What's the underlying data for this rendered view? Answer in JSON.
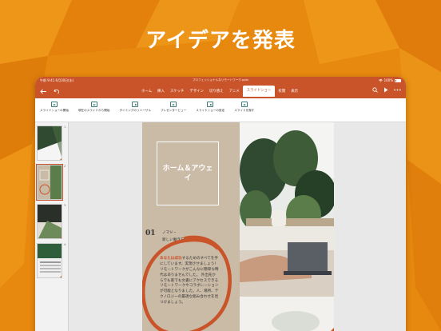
{
  "headline": "アイデアを発表",
  "colors": {
    "accent": "#C9542A",
    "background": "#E8890F",
    "slide_beige": "#CABBA7"
  },
  "status": {
    "time": "午前 9:41",
    "date": "6月30日(水)",
    "battery": "100%"
  },
  "doc_title": "プロフェッショナルなリモートワーク.pptx",
  "nav": {
    "back_icon": "back-arrow-icon",
    "undo_icon": "undo-icon"
  },
  "tabs": [
    "ホーム",
    "挿入",
    "スケッチ",
    "デザイン",
    "切り替え",
    "アニメ",
    "スライドショー",
    "校閲",
    "表示"
  ],
  "active_tab": "スライドショー",
  "toolbar": [
    {
      "label": "スライドショーの開始",
      "icon": "play-slideshow-icon"
    },
    {
      "label": "現在のスライドから開始",
      "icon": "play-from-current-icon"
    },
    {
      "label": "タイミングのリハーサル",
      "icon": "rehearse-timings-icon"
    },
    {
      "label": "プレゼンタービュー",
      "icon": "presenter-view-icon"
    },
    {
      "label": "スライドショーの設定",
      "icon": "slideshow-settings-icon"
    },
    {
      "label": "スライドを隠す",
      "icon": "hide-slide-icon"
    }
  ],
  "thumbnails": [
    {
      "num": "1",
      "selected": false
    },
    {
      "num": "2",
      "selected": true
    },
    {
      "num": "3",
      "selected": false
    },
    {
      "num": "4",
      "selected": false
    }
  ],
  "slide": {
    "title": "ホーム＆アウェイ",
    "section_number": "01",
    "section_lines": [
      "ノマド・",
      "新しい働き方"
    ],
    "body_highlight": "あなたは成功",
    "body_text": "するためのすべてを手にしています。実現させましょう！ リモートワークがこんなに簡単な時代はありませんでした。 外出先からでも家でも文書にアクセスできるリモートワークやコラボレーションが可能となりました。人、場所、テクノロジーの最適な組み合わせを見つけましょう。"
  }
}
